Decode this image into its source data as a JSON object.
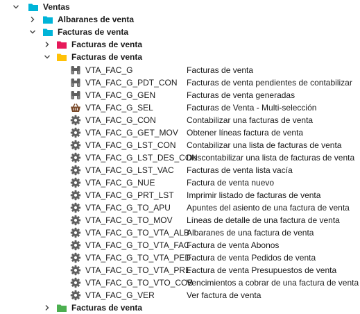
{
  "colors": {
    "folder_cyan": "#00b4d8",
    "folder_pink": "#e6195a",
    "folder_yellow": "#ffc107",
    "folder_green": "#4caf50",
    "icon_gray": "#5f5f5f",
    "basket_brown": "#7a4a2a"
  },
  "tree": {
    "root": {
      "label": "Ventas",
      "expanded": true,
      "folder_color": "cyan"
    },
    "albaranes": {
      "label": "Albaranes de venta",
      "expanded": false,
      "folder_color": "cyan"
    },
    "facturas": {
      "label": "Facturas de venta",
      "expanded": true,
      "folder_color": "cyan"
    },
    "facturas_pink": {
      "label": "Facturas de venta",
      "expanded": false,
      "folder_color": "pink"
    },
    "facturas_yellow": {
      "label": "Facturas de venta",
      "expanded": true,
      "folder_color": "yellow"
    },
    "facturas_green": {
      "label": "Facturas de venta",
      "expanded": false,
      "folder_color": "green"
    },
    "items": [
      {
        "code": "VTA_FAC_G",
        "desc": "Facturas de venta",
        "icon": "binoculars-icon"
      },
      {
        "code": "VTA_FAC_G_PDT_CON",
        "desc": "Facturas de venta pendientes de contabilizar",
        "icon": "binoculars-icon"
      },
      {
        "code": "VTA_FAC_G_GEN",
        "desc": "Facturas de venta generadas",
        "icon": "binoculars-icon"
      },
      {
        "code": "VTA_FAC_G_SEL",
        "desc": "Facturas de Venta - Multi-selección",
        "icon": "basket-icon"
      },
      {
        "code": "VTA_FAC_G_CON",
        "desc": "Contabilizar una facturas de venta",
        "icon": "gear-icon"
      },
      {
        "code": "VTA_FAC_G_GET_MOV",
        "desc": "Obtener líneas factura de venta",
        "icon": "gear-icon"
      },
      {
        "code": "VTA_FAC_G_LST_CON",
        "desc": "Contabilizar una lista de facturas de venta",
        "icon": "gear-icon"
      },
      {
        "code": "VTA_FAC_G_LST_DES_CON",
        "desc": "Descontabilizar una lista de facturas de venta",
        "icon": "gear-icon"
      },
      {
        "code": "VTA_FAC_G_LST_VAC",
        "desc": "Facturas de venta lista vacía",
        "icon": "gear-icon"
      },
      {
        "code": "VTA_FAC_G_NUE",
        "desc": "Factura de venta nuevo",
        "icon": "gear-icon"
      },
      {
        "code": "VTA_FAC_G_PRT_LST",
        "desc": "Imprimir listado de facturas de venta",
        "icon": "gear-icon"
      },
      {
        "code": "VTA_FAC_G_TO_APU",
        "desc": "Apuntes del asiento de una factura de venta",
        "icon": "gear-icon"
      },
      {
        "code": "VTA_FAC_G_TO_MOV",
        "desc": "Líneas de detalle de una factura de venta",
        "icon": "gear-icon"
      },
      {
        "code": "VTA_FAC_G_TO_VTA_ALB",
        "desc": "Albaranes de una factura de venta",
        "icon": "gear-icon"
      },
      {
        "code": "VTA_FAC_G_TO_VTA_FAC",
        "desc": "Factura de venta Abonos",
        "icon": "gear-icon"
      },
      {
        "code": "VTA_FAC_G_TO_VTA_PED",
        "desc": "Factura de venta Pedidos de venta",
        "icon": "gear-icon"
      },
      {
        "code": "VTA_FAC_G_TO_VTA_PRE",
        "desc": "Factura de venta Presupuestos de venta",
        "icon": "gear-icon"
      },
      {
        "code": "VTA_FAC_G_TO_VTO_COB",
        "desc": "Vencimientos a cobrar de una factura de venta",
        "icon": "gear-icon"
      },
      {
        "code": "VTA_FAC_G_VER",
        "desc": "Ver factura de venta",
        "icon": "gear-icon"
      }
    ]
  }
}
